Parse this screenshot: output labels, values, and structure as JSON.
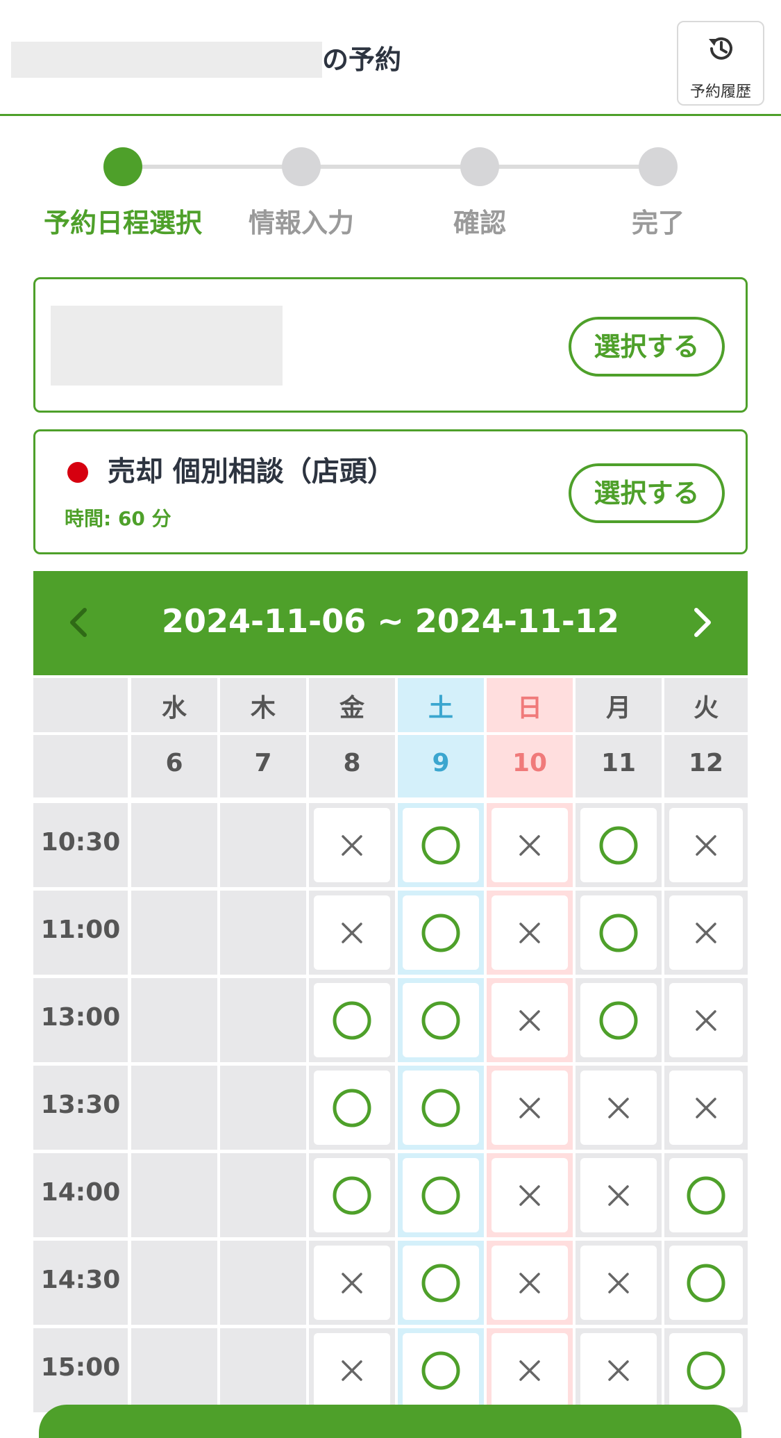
{
  "header": {
    "title_suffix": "の予約",
    "history_label": "予約履歴",
    "history_icon": "history-icon"
  },
  "steps": [
    {
      "label": "予約日程選択",
      "active": true
    },
    {
      "label": "情報入力",
      "active": false
    },
    {
      "label": "確認",
      "active": false
    },
    {
      "label": "完了",
      "active": false
    }
  ],
  "card_staff": {
    "select_label": "選択する"
  },
  "card_service": {
    "name": "売却 個別相談（店頭）",
    "time_text": "時間: 60 分",
    "select_label": "選択する",
    "dot_color": "#d6000f"
  },
  "calendar": {
    "range": "2024-11-06 ~ 2024-11-12",
    "prev_icon": "chevron-left-icon",
    "next_icon": "chevron-right-icon",
    "days": [
      {
        "weekday": "水",
        "date": "6",
        "kind": "weekday"
      },
      {
        "weekday": "木",
        "date": "7",
        "kind": "weekday"
      },
      {
        "weekday": "金",
        "date": "8",
        "kind": "weekday"
      },
      {
        "weekday": "土",
        "date": "9",
        "kind": "saturday"
      },
      {
        "weekday": "日",
        "date": "10",
        "kind": "sunday"
      },
      {
        "weekday": "月",
        "date": "11",
        "kind": "weekday"
      },
      {
        "weekday": "火",
        "date": "12",
        "kind": "weekday"
      }
    ],
    "slots": [
      {
        "time": "10:30",
        "status": [
          "",
          "",
          "×",
          "○",
          "×",
          "○",
          "×"
        ]
      },
      {
        "time": "11:00",
        "status": [
          "",
          "",
          "×",
          "○",
          "×",
          "○",
          "×"
        ]
      },
      {
        "time": "13:00",
        "status": [
          "",
          "",
          "○",
          "○",
          "×",
          "○",
          "×"
        ]
      },
      {
        "time": "13:30",
        "status": [
          "",
          "",
          "○",
          "○",
          "×",
          "×",
          "×"
        ]
      },
      {
        "time": "14:00",
        "status": [
          "",
          "",
          "○",
          "○",
          "×",
          "×",
          "○"
        ]
      },
      {
        "time": "14:30",
        "status": [
          "",
          "",
          "×",
          "○",
          "×",
          "×",
          "○"
        ]
      },
      {
        "time": "15:00",
        "status": [
          "",
          "",
          "×",
          "○",
          "×",
          "×",
          "○"
        ]
      }
    ]
  },
  "colors": {
    "brand_green": "#4ea02a",
    "saturday_bg": "#d4f0fa",
    "saturday_text": "#3aa6cf",
    "sunday_bg": "#ffdede",
    "sunday_text": "#f07a7a",
    "cell_gray": "#e8e8ea",
    "cross_gray": "#666666"
  }
}
